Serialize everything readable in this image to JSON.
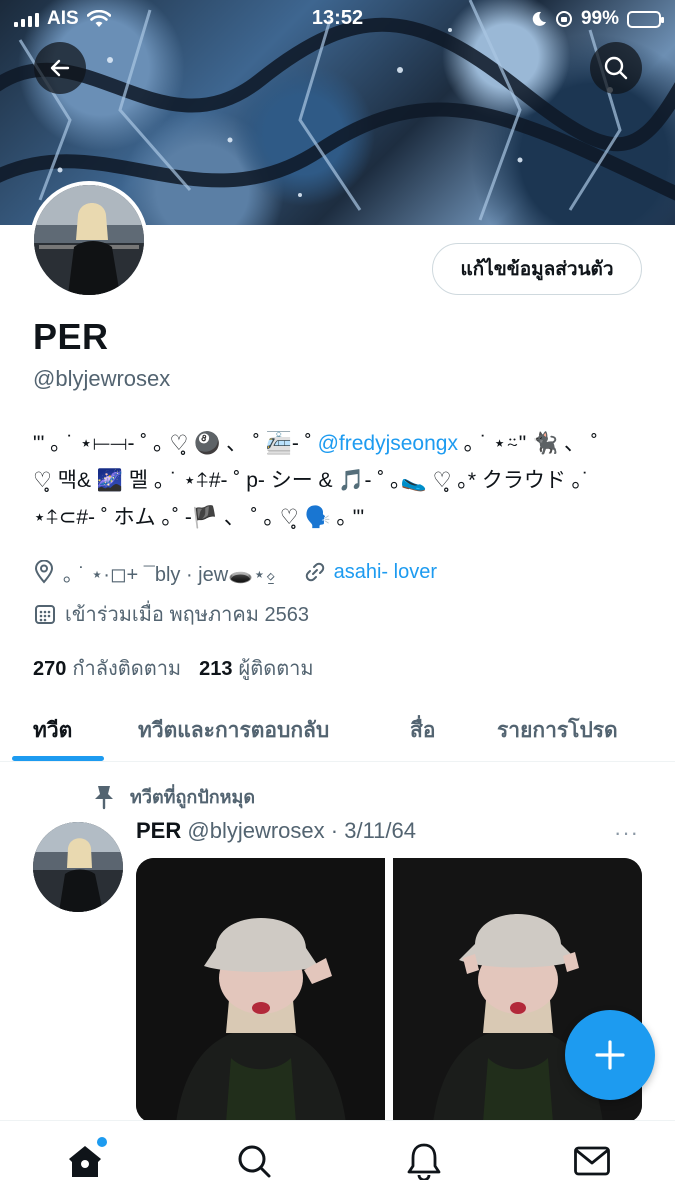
{
  "status_bar": {
    "carrier": "AIS",
    "time": "13:52",
    "battery_pct": "99%",
    "battery_level": 0.99
  },
  "header": {
    "back_icon": "arrow-left-icon",
    "search_icon": "search-icon"
  },
  "profile": {
    "edit_button": "แก้ไขข้อมูลส่วนตัว",
    "name": "PER",
    "handle": "@blyjewrosex",
    "bio_line1_before": "\"' ｡ ˙ ⋆⟝⟞- ˚ ｡ ♡̥ 🎱 、 ˚ 🚈- ˚ ",
    "bio_mention": "@fredyjseongx",
    "bio_line1_after": " ｡ ˙ ⋆⍨\" 🐈‍⬛ 、 ˚",
    "bio_line2": "♡̥ 맥& 🌌 멜 ｡ ˙ ⋆⍏#- ˚ p- シー & 🎵- ˚ ｡🥿 ♡̥ ｡* クラウド ｡˙",
    "bio_line3": "⋆⍏⊂#- ˚ ホム ｡˚ -🏴 、 ˚ ｡ ♡̥ 🗣️ ｡ \"'",
    "location": "｡ ˙ ⋆·◻+ ¯bly · jew🕳️⋆⍚",
    "website": "asahi- lover",
    "joined": "เข้าร่วมเมื่อ พฤษภาคม 2563",
    "following_count": "270",
    "following_label": "กำลังติดตาม",
    "followers_count": "213",
    "followers_label": "ผู้ติดตาม"
  },
  "tabs": [
    {
      "label": "ทวีต",
      "active": true
    },
    {
      "label": "ทวีตและการตอบกลับ",
      "active": false
    },
    {
      "label": "สื่อ",
      "active": false
    },
    {
      "label": "รายการโปรด",
      "active": false
    }
  ],
  "pinned_tweet": {
    "pinned_label": "ทวีตที่ถูกปักหมุด",
    "author_name": "PER",
    "author_handle": "@blyjewrosex",
    "separator": "·",
    "date": "3/11/64",
    "more": "···"
  },
  "bottom_nav": [
    {
      "icon": "home-icon"
    },
    {
      "icon": "search-icon"
    },
    {
      "icon": "bell-icon"
    },
    {
      "icon": "mail-icon"
    }
  ],
  "colors": {
    "accent": "#1d9bf0",
    "text": "#0f1419",
    "muted": "#536471"
  }
}
